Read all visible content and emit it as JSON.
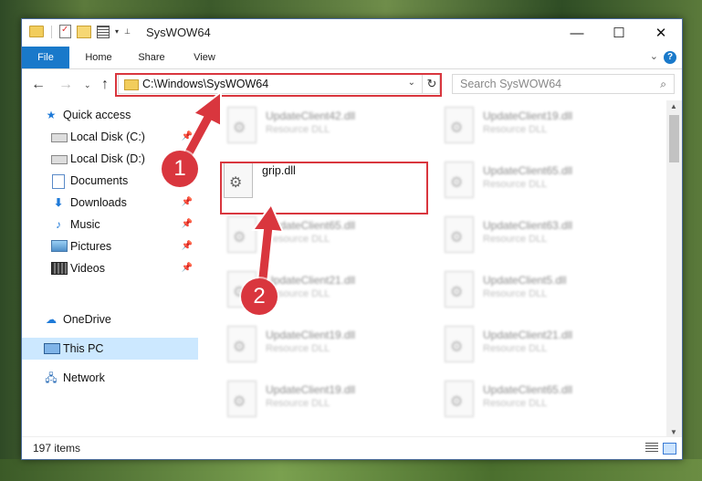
{
  "window": {
    "title": "SysWOW64",
    "controls": {
      "minimize": "—",
      "maximize": "☐",
      "close": "✕"
    }
  },
  "ribbon": {
    "tabs": [
      "File",
      "Home",
      "Share",
      "View"
    ],
    "chevron": "⌄",
    "help": "?"
  },
  "nav": {
    "back": "←",
    "forward": "→",
    "recent": "⌄",
    "up": "↑",
    "address": "C:\\Windows\\SysWOW64",
    "address_dropdown": "⌄",
    "refresh": "↻",
    "search_placeholder": "Search SysWOW64"
  },
  "sidebar": {
    "items": [
      {
        "label": "Quick access",
        "icon": "star-icon"
      },
      {
        "label": "Local Disk (C:)",
        "icon": "drive-icon",
        "pinned": true
      },
      {
        "label": "Local Disk (D:)",
        "icon": "drive-icon",
        "pinned": true
      },
      {
        "label": "Documents",
        "icon": "documents-icon",
        "pinned": true
      },
      {
        "label": "Downloads",
        "icon": "downloads-icon",
        "pinned": true
      },
      {
        "label": "Music",
        "icon": "music-icon",
        "pinned": true
      },
      {
        "label": "Pictures",
        "icon": "pictures-icon",
        "pinned": true
      },
      {
        "label": "Videos",
        "icon": "videos-icon",
        "pinned": true
      },
      {
        "label": "OneDrive",
        "icon": "onedrive-icon"
      },
      {
        "label": "This PC",
        "icon": "computer-icon",
        "selected": true
      },
      {
        "label": "Network",
        "icon": "network-icon"
      }
    ],
    "pin_glyph": "📌"
  },
  "files": {
    "left": [
      {
        "name": "UpdateClient42.dll",
        "type": "Resource DLL"
      },
      {
        "name": "grip.dll",
        "type": ""
      },
      {
        "name": "UpdateClient65.dll",
        "type": "Resource DLL"
      },
      {
        "name": "UpdateClient21.dll",
        "type": "Resource DLL"
      },
      {
        "name": "UpdateClient19.dll",
        "type": "Resource DLL"
      },
      {
        "name": "UpdateClient19.dll",
        "type": "Resource DLL"
      }
    ],
    "right": [
      {
        "name": "UpdateClient19.dll",
        "type": "Resource DLL"
      },
      {
        "name": "UpdateClient65.dll",
        "type": "Resource DLL"
      },
      {
        "name": "UpdateClient63.dll",
        "type": "Resource DLL"
      },
      {
        "name": "UpdateClient5.dll",
        "type": "Resource DLL"
      },
      {
        "name": "UpdateClient21.dll",
        "type": "Resource DLL"
      },
      {
        "name": "UpdateClient65.dll",
        "type": "Resource DLL"
      }
    ]
  },
  "status": {
    "item_count": "197 items"
  },
  "annotations": {
    "step1": "1",
    "step2": "2",
    "color": "#d9363e"
  }
}
